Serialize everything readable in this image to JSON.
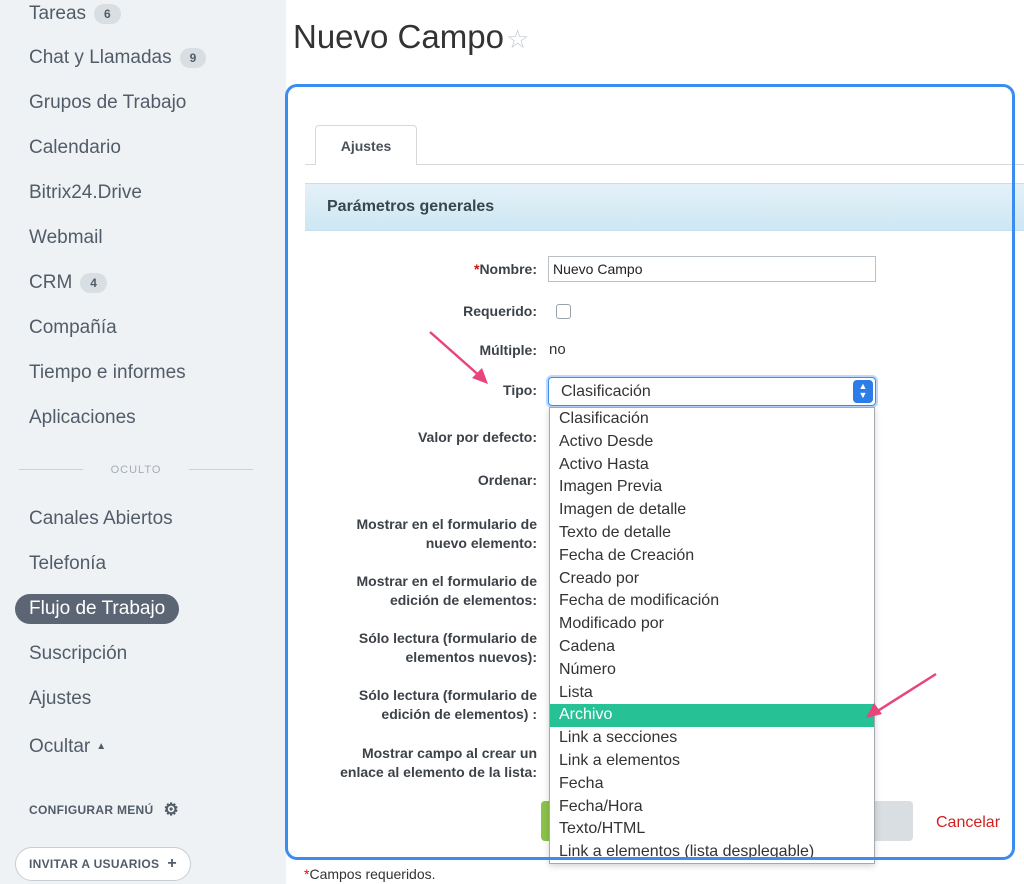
{
  "sidebar": {
    "items": [
      {
        "label": "Tareas",
        "counter": "6"
      },
      {
        "label": "Chat y Llamadas",
        "counter": "9"
      },
      {
        "label": "Grupos de Trabajo"
      },
      {
        "label": "Calendario"
      },
      {
        "label": "Bitrix24.Drive"
      },
      {
        "label": "Webmail"
      },
      {
        "label": "CRM",
        "counter": "4"
      },
      {
        "label": "Compañía"
      },
      {
        "label": "Tiempo e informes"
      },
      {
        "label": "Aplicaciones"
      }
    ],
    "hidden_label": "OCULTO",
    "hidden_items": [
      {
        "label": "Canales Abiertos"
      },
      {
        "label": "Telefonía"
      },
      {
        "label": "Flujo de Trabajo",
        "active": true
      },
      {
        "label": "Suscripción"
      },
      {
        "label": "Ajustes"
      }
    ],
    "hide_toggle": "Ocultar",
    "configure_menu": "CONFIGURAR MENÚ",
    "invite_users": "INVITAR A USUARIOS"
  },
  "header": {
    "title": "Nuevo Campo"
  },
  "tabs": [
    {
      "label": "Ajustes"
    }
  ],
  "section": {
    "title": "Parámetros generales"
  },
  "form": {
    "nombre_label": "Nombre:",
    "nombre_value": "Nuevo Campo",
    "requerido_label": "Requerido:",
    "requerido_checked": false,
    "multiple_label": "Múltiple:",
    "multiple_value": "no",
    "tipo_label": "Tipo:",
    "tipo_value": "Clasificación",
    "valor_defecto_label": "Valor por defecto:",
    "ordenar_label": "Ordenar:",
    "mostrar_nuevo_label_1": "Mostrar en el formulario de",
    "mostrar_nuevo_label_2": "nuevo elemento:",
    "mostrar_edicion_label_1": "Mostrar en el formulario de",
    "mostrar_edicion_label_2": "edición de elementos:",
    "lectura_nuevos_label_1": "Sólo lectura (formulario de",
    "lectura_nuevos_label_2": "elementos nuevos):",
    "lectura_edicion_label_1": "Sólo lectura (formulario de",
    "lectura_edicion_label_2": "edición de elementos) :",
    "mostrar_enlace_label_1": "Mostrar campo al crear un",
    "mostrar_enlace_label_2": "enlace al elemento de la lista:",
    "cancel": "Cancelar",
    "required_note": "Campos requeridos."
  },
  "tipo_options": [
    "Clasificación",
    "Activo Desde",
    "Activo Hasta",
    "Imagen Previa",
    "Imagen de detalle",
    "Texto de detalle",
    "Fecha de Creación",
    "Creado por",
    "Fecha de modificación",
    "Modificado por",
    "Cadena",
    "Número",
    "Lista",
    "Archivo",
    "Link a secciones",
    "Link a elementos",
    "Fecha",
    "Fecha/Hora",
    "Texto/HTML",
    "Link a elementos (lista desplegable)"
  ],
  "tipo_highlighted": "Archivo",
  "colors": {
    "accent": "#26c195",
    "annotation": "#e8457a",
    "frame": "#3b8cf0",
    "active_nav": "#5b6573"
  }
}
